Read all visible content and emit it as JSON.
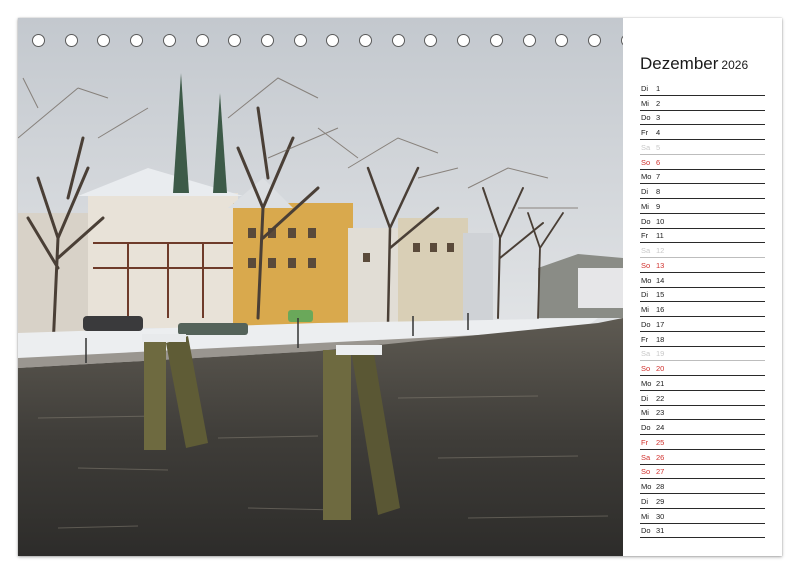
{
  "calendar": {
    "month": "Dezember",
    "year": "2026",
    "days": [
      {
        "dn": "Di",
        "dd": "1",
        "kind": "week"
      },
      {
        "dn": "Mi",
        "dd": "2",
        "kind": "week"
      },
      {
        "dn": "Do",
        "dd": "3",
        "kind": "week"
      },
      {
        "dn": "Fr",
        "dd": "4",
        "kind": "week"
      },
      {
        "dn": "Sa",
        "dd": "5",
        "kind": "sat"
      },
      {
        "dn": "So",
        "dd": "6",
        "kind": "sun"
      },
      {
        "dn": "Mo",
        "dd": "7",
        "kind": "week"
      },
      {
        "dn": "Di",
        "dd": "8",
        "kind": "week"
      },
      {
        "dn": "Mi",
        "dd": "9",
        "kind": "week"
      },
      {
        "dn": "Do",
        "dd": "10",
        "kind": "week"
      },
      {
        "dn": "Fr",
        "dd": "11",
        "kind": "week"
      },
      {
        "dn": "Sa",
        "dd": "12",
        "kind": "sat"
      },
      {
        "dn": "So",
        "dd": "13",
        "kind": "sun"
      },
      {
        "dn": "Mo",
        "dd": "14",
        "kind": "week"
      },
      {
        "dn": "Di",
        "dd": "15",
        "kind": "week"
      },
      {
        "dn": "Mi",
        "dd": "16",
        "kind": "week"
      },
      {
        "dn": "Do",
        "dd": "17",
        "kind": "week"
      },
      {
        "dn": "Fr",
        "dd": "18",
        "kind": "week"
      },
      {
        "dn": "Sa",
        "dd": "19",
        "kind": "sat"
      },
      {
        "dn": "So",
        "dd": "20",
        "kind": "sun"
      },
      {
        "dn": "Mo",
        "dd": "21",
        "kind": "week"
      },
      {
        "dn": "Di",
        "dd": "22",
        "kind": "week"
      },
      {
        "dn": "Mi",
        "dd": "23",
        "kind": "week"
      },
      {
        "dn": "Do",
        "dd": "24",
        "kind": "week"
      },
      {
        "dn": "Fr",
        "dd": "25",
        "kind": "holiday"
      },
      {
        "dn": "Sa",
        "dd": "26",
        "kind": "holiday"
      },
      {
        "dn": "So",
        "dd": "27",
        "kind": "sun"
      },
      {
        "dn": "Mo",
        "dd": "28",
        "kind": "week"
      },
      {
        "dn": "Di",
        "dd": "29",
        "kind": "week"
      },
      {
        "dn": "Mi",
        "dd": "30",
        "kind": "week"
      },
      {
        "dn": "Do",
        "dd": "31",
        "kind": "week"
      }
    ]
  },
  "binding": {
    "hole_count": 23
  },
  "colors": {
    "sunday_holiday": "#d0312d",
    "saturday": "#c8c8c8",
    "text": "#1a1a1a",
    "sky": "#d9dde1",
    "water": "#4a4a4a"
  }
}
